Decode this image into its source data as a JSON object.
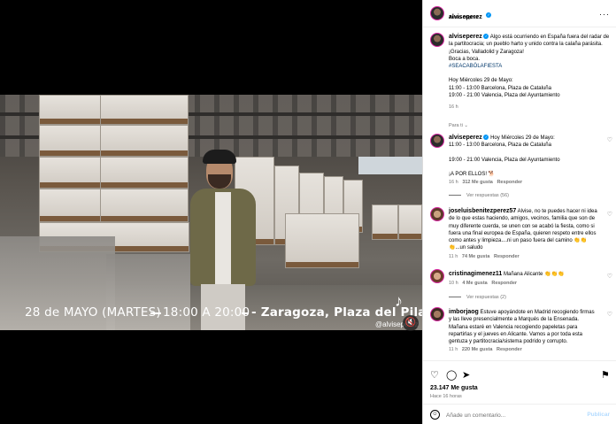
{
  "video": {
    "overlay_date": "28 de MAYO (MARTES)",
    "overlay_time": "18:00 A 20:00",
    "overlay_place": "- Zaragoza, Plaza del Pilar",
    "tiktok_brand": "TikTok",
    "tiktok_handle": "@alviseperez"
  },
  "header": {
    "username": "alviseperez",
    "audio": "Audio original"
  },
  "caption": {
    "username": "alviseperez",
    "line1": "Algo está ocurriendo en España fuera del radar de la partitocracia; un pueblo harto y unido contra la calaña parásita.",
    "line2": "¡Gracias, Valladolid y Zaragoza!",
    "line3": "Boca a boca.",
    "hashtag": "#SEACABÓLAFIESTA",
    "line4": "Hoy Miércoles 29 de Mayo:",
    "line5": "11:00 - 13:00 Barcelona, Plaza de Cataluña",
    "line6": "19:00 - 21:00 Valencia, Plaza del Ayuntamiento",
    "time": "16 h"
  },
  "see_translation": "Para ti",
  "comments": [
    {
      "username": "alviseperez",
      "text_a": "Hoy Miércoles 29 de Mayo:",
      "text_b": "11:00 - 13:00 Barcelona, Plaza de Cataluña",
      "text_c": "19:00 - 21:00 Valencia, Plaza del Ayuntamiento",
      "text_d": "¡A POR ELLOS! 🐕",
      "time": "16 h",
      "likes": "312 Me gusta",
      "reply": "Responder",
      "replies": "Ver respuestas (56)"
    },
    {
      "username": "joseluisbenitezperez57",
      "text": "Alvise, no te puedes hacer ni idea de lo que estas haciendo, amigos, vecinos, familia que son de muy diferente cuerda, se unen con se acabó la fiesta, como si fuera una final europea de España, quieren respeto entre ellos como antes y limpieza....ni un paso fuera del camino 👏👏👏...un saludo",
      "time": "11 h",
      "likes": "74 Me gusta",
      "reply": "Responder"
    },
    {
      "username": "cristinagimenez11",
      "text": "Mañana Alicante 👏👏👏",
      "time": "10 h",
      "likes": "4 Me gusta",
      "reply": "Responder",
      "replies": "Ver respuestas (2)"
    },
    {
      "username": "imborjaog",
      "text": "Estuve apoyándote en Madrid recogiendo firmas y las lleve presencialmente a Marqués de la Ensenada. Mañana estaré en Valencia recogiendo papeletas para repartirlas y el jueves en Alicante. Vamos a por toda esta gentuza y partitocracia/sistema podrido y corrupto.",
      "time": "11 h",
      "likes": "220 Me gusta",
      "reply": "Responder"
    }
  ],
  "footer": {
    "likes": "23.147 Me gusta",
    "ago": "Hace 16 horas",
    "placeholder": "Añade un comentario...",
    "post": "Publicar"
  }
}
